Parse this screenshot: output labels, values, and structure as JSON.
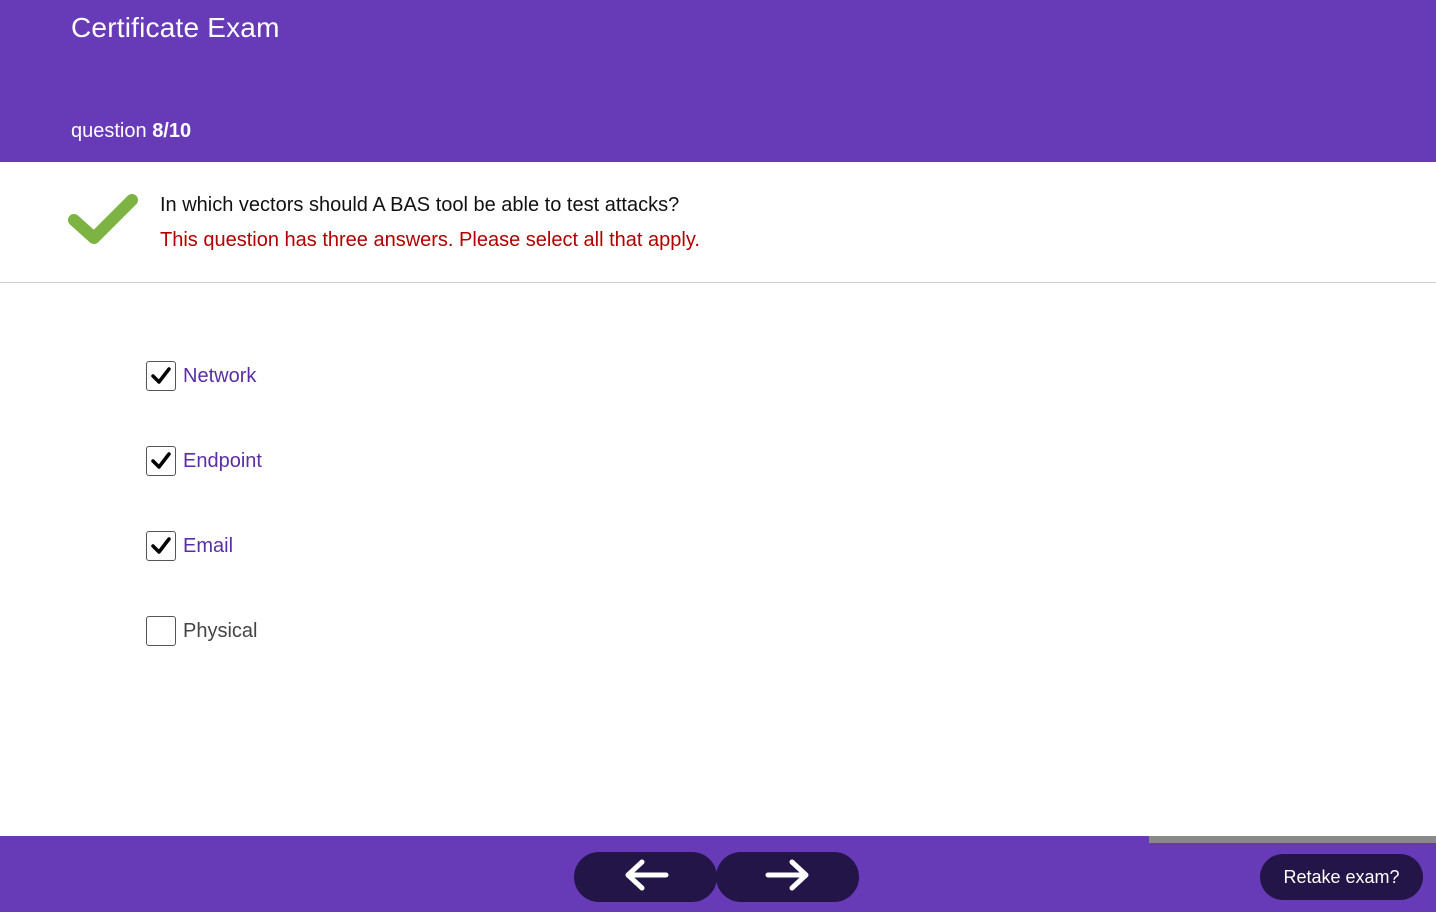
{
  "header": {
    "title": "Certificate Exam",
    "counter_prefix": "question",
    "counter_value": "8/10",
    "background": "#673ab7"
  },
  "question": {
    "status_icon": "checkmark-icon",
    "status_color": "#7cb342",
    "text": "In which vectors should A BAS tool be able to test attacks?",
    "hint": "This question has three answers. Please select all that apply.",
    "hint_color": "#b00000"
  },
  "answers": [
    {
      "label": "Network",
      "checked": true
    },
    {
      "label": "Endpoint",
      "checked": true
    },
    {
      "label": "Email",
      "checked": true
    },
    {
      "label": "Physical",
      "checked": false
    }
  ],
  "progress": {
    "current": 8,
    "total": 10,
    "fraction": 0.8
  },
  "footer": {
    "prev_icon": "arrow-left-icon",
    "next_icon": "arrow-right-icon",
    "retake_label": "Retake exam?"
  }
}
